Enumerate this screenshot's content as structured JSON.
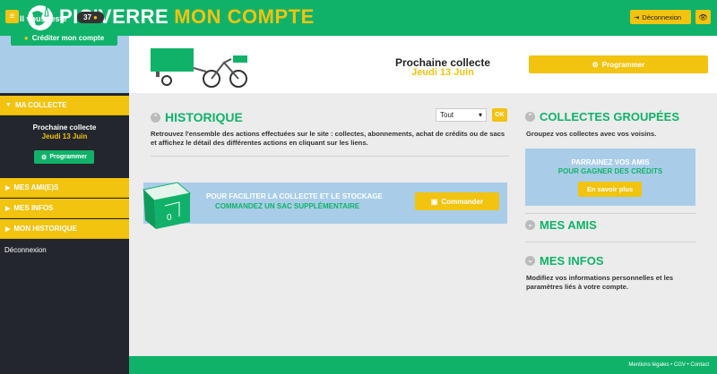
{
  "header": {
    "brand_main": "PIC'VERRE",
    "brand_accent": "MON COMPTE",
    "logout_label": "Déconnexion",
    "menu_icon": "hamburger-icon",
    "logout_icon": "sign-out-icon",
    "eye_icon": "eye-icon"
  },
  "sidebar": {
    "remain_label": "Il vous reste",
    "remain_count": "37",
    "credit_button": "Créditer mon compte",
    "sections": [
      {
        "label": "MA COLLECTE",
        "expanded": true
      },
      {
        "label": "MES AMI(E)S",
        "expanded": false
      },
      {
        "label": "MES INFOS",
        "expanded": false
      },
      {
        "label": "MON HISTORIQUE",
        "expanded": false
      }
    ],
    "collecte_title": "Prochaine collecte",
    "collecte_date": "Jeudi 13 Juin",
    "collecte_button": "Programmer",
    "logout_link": "Déconnexion"
  },
  "banner": {
    "next_title": "Prochaine collecte",
    "next_date": "Jeudi 13 Juin",
    "program_button": "Programmer"
  },
  "historique": {
    "title": "HISTORIQUE",
    "filter_value": "Tout",
    "ok_label": "OK",
    "description": "Retrouvez l'ensemble des actions effectuées sur le site : collectes, abonnements, achat de crédits ou de sacs et affichez le détail des différentes actions en cliquant sur les liens.",
    "promo_line1": "POUR FACILITER LA COLLECTE ET LE STOCKAGE",
    "promo_line2": "COMMANDEZ UN SAC SUPPLÉMENTAIRE",
    "order_button": "Commander"
  },
  "right": {
    "grouped_title": "COLLECTES GROUPÉES",
    "grouped_desc": "Groupez vos collectes avec vos voisins.",
    "parrain_l1": "PARRAINEZ VOS AMIS",
    "parrain_l2": "POUR GAGNER DES CRÉDITS",
    "learn_more": "En savoir plus",
    "friends_title": "MES AMIS",
    "infos_title": "MES INFOS",
    "infos_desc": "Modifiez vos informations personnelles et les paramètres liés à votre compte."
  },
  "footer": {
    "links": "Mentions légales • CGV • Contact"
  },
  "colors": {
    "green": "#10b26a",
    "yellow": "#f2c30f",
    "light_blue": "#a9cde8",
    "sidebar_dark": "#23262d"
  }
}
